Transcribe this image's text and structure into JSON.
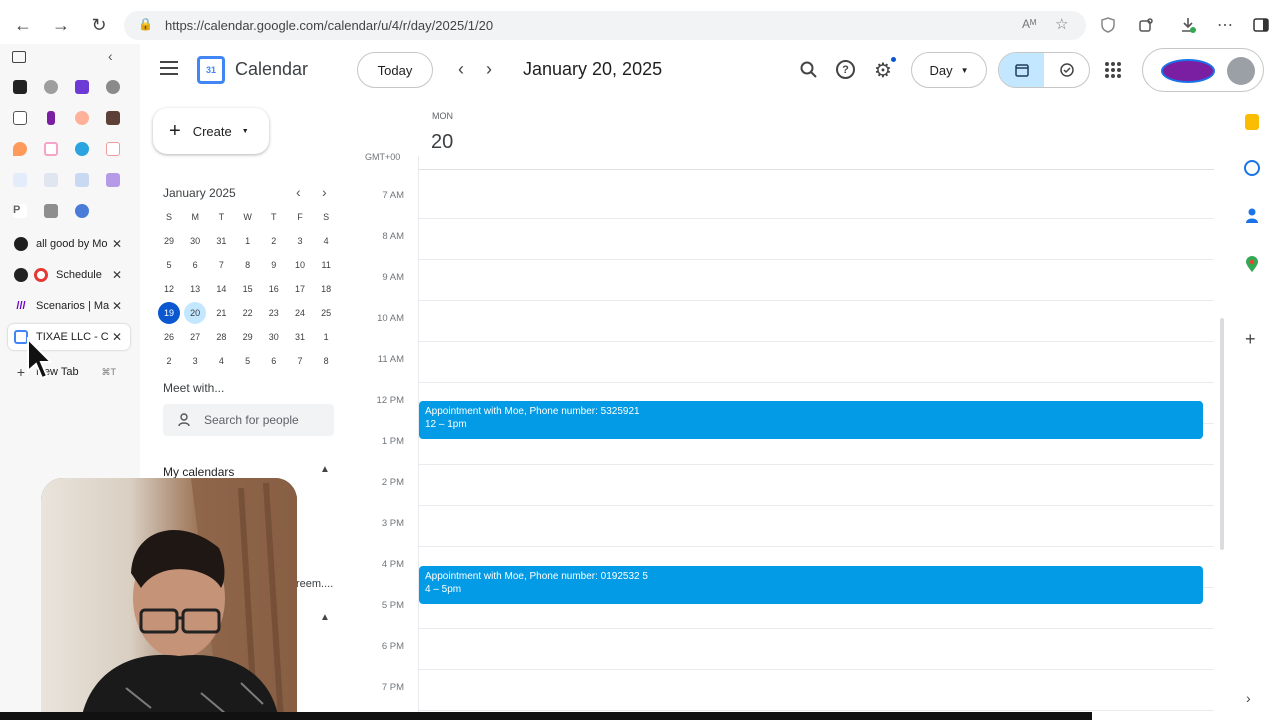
{
  "browser": {
    "url": "https://calendar.google.com/calendar/u/4/r/day/2025/1/20",
    "icons": [
      "back-icon",
      "forward-icon",
      "reload-icon",
      "site-info-icon",
      "read-aloud-icon",
      "favorite-icon",
      "shield-icon",
      "extensions-icon",
      "downloads-icon",
      "more-icon",
      "sidebar-icon"
    ]
  },
  "vertical_tabs": {
    "tabs": [
      {
        "label": "all good by Mo",
        "icon": "github-icon",
        "color": "#1f1f1f"
      },
      {
        "label": "Schedule",
        "icon": "schedule-app-icon",
        "color": "#e53935"
      },
      {
        "label": "Scenarios | Ma",
        "icon": "make-icon",
        "color": "#6d00cc"
      },
      {
        "label": "TIXAE LLC - C",
        "icon": "google-calendar-icon",
        "color": "#4285f4"
      }
    ],
    "new_tab_label": "New Tab",
    "new_tab_shortcut": "⌘T"
  },
  "calendar": {
    "app_title": "Calendar",
    "logo_day": "31",
    "today_label": "Today",
    "date_title": "January 20, 2025",
    "view_label": "Day",
    "create_label": "Create",
    "accent": "#0b57d0",
    "event_color": "#039be5"
  },
  "mini_calendar": {
    "month_label": "January 2025",
    "weekday_headers": [
      "S",
      "M",
      "T",
      "W",
      "T",
      "F",
      "S"
    ],
    "weeks": [
      [
        "29",
        "30",
        "31",
        "1",
        "2",
        "3",
        "4"
      ],
      [
        "5",
        "6",
        "7",
        "8",
        "9",
        "10",
        "11"
      ],
      [
        "12",
        "13",
        "14",
        "15",
        "16",
        "17",
        "18"
      ],
      [
        "19",
        "20",
        "21",
        "22",
        "23",
        "24",
        "25"
      ],
      [
        "26",
        "27",
        "28",
        "29",
        "30",
        "31",
        "1"
      ],
      [
        "2",
        "3",
        "4",
        "5",
        "6",
        "7",
        "8"
      ]
    ],
    "today": "19",
    "selected": "20"
  },
  "meet_with": {
    "heading": "Meet with...",
    "search_placeholder": "Search for people"
  },
  "my_calendars": {
    "heading": "My calendars",
    "partial_text": "reem...."
  },
  "day_view": {
    "weekday": "MON",
    "day_number": "20",
    "timezone": "GMT+00",
    "hours": [
      "7 AM",
      "8 AM",
      "9 AM",
      "10 AM",
      "11 AM",
      "12 PM",
      "1 PM",
      "2 PM",
      "3 PM",
      "4 PM",
      "5 PM",
      "6 PM",
      "7 PM"
    ],
    "events": [
      {
        "title": "Appointment with Moe, Phone number: 5325921",
        "time": "12 – 1pm"
      },
      {
        "title": "Appointment with Moe, Phone number: 0192532 5",
        "time": "4 – 5pm"
      }
    ]
  }
}
